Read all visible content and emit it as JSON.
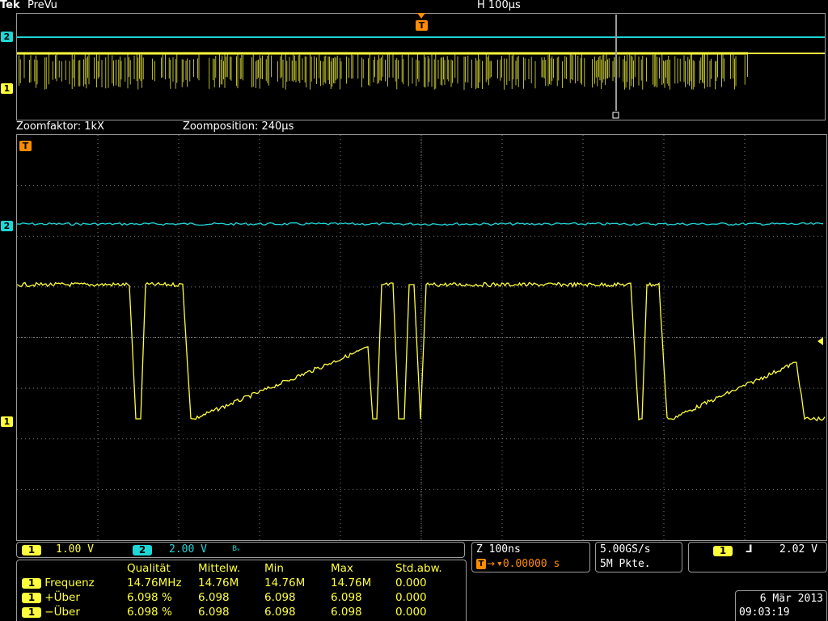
{
  "header": {
    "brand": "Tek",
    "mode": "PreVu",
    "horizontal": "H 100µs"
  },
  "zoom_bar": {
    "factor": "Zoomfaktor: 1kX",
    "position": "Zoomposition: 240µs"
  },
  "markers": {
    "ch1": "1",
    "ch2": "2",
    "trigger": "T"
  },
  "vertical": {
    "ch1_scale": "1.00 V",
    "ch2_scale": "2.00 V",
    "bandwidth_tag": "Bᵥ"
  },
  "timebase": {
    "zoom": "Z 100ns",
    "trigger_pos": "▾0.00000 s",
    "sample_rate": "5.00GS/s",
    "record_length": "5M Pkte."
  },
  "trigger": {
    "source": "1",
    "slope_symbol": "⅃",
    "level": "2.02 V"
  },
  "measurements": {
    "headers": [
      "Qualität",
      "Mittelw.",
      "Min",
      "Max",
      "Std.abw."
    ],
    "rows": [
      {
        "chip": "1",
        "name": "Frequenz",
        "cells": [
          "14.76MHz",
          "14.76M",
          "14.76M",
          "14.76M",
          "0.000"
        ]
      },
      {
        "chip": "1",
        "name": "+Über",
        "cells": [
          "6.098 %",
          "6.098",
          "6.098",
          "6.098",
          "0.000"
        ]
      },
      {
        "chip": "1",
        "name": "−Über",
        "cells": [
          "6.098 %",
          "6.098",
          "6.098",
          "6.098",
          "0.000"
        ]
      }
    ]
  },
  "datetime": {
    "date": "6 Mär 2013",
    "time": "09:03:19"
  },
  "colors": {
    "ch1": "#ffff3c",
    "ch2": "#1fd6d6",
    "trigger": "#ff8c00",
    "grid": "#7a7a7a",
    "frame": "#9a9a9a"
  }
}
